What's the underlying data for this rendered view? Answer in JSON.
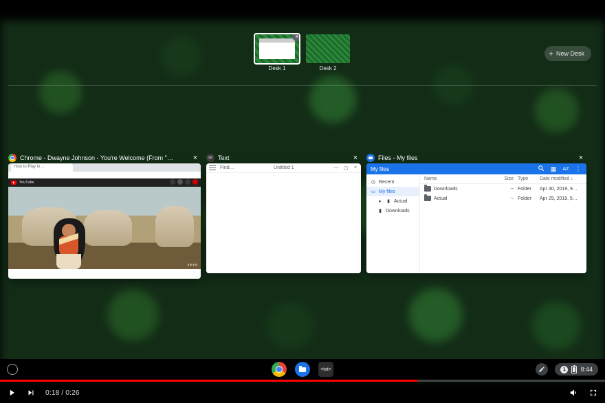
{
  "desks": {
    "items": [
      {
        "label": "Desk 1",
        "active": true
      },
      {
        "label": "Desk 2",
        "active": false
      }
    ],
    "new_desk_label": "New Desk"
  },
  "overview": {
    "windows": [
      {
        "id": "chrome",
        "title": "Chrome - Dwayne Johnson - You're Welcome (From \"…",
        "tab_label": "How to Play in…",
        "yt_brand": "YouTube",
        "video_watermark": "vevo"
      },
      {
        "id": "text",
        "title": "Text",
        "find_label": "Find…",
        "doc_title": "Untitled 1"
      },
      {
        "id": "files",
        "title": "Files - My files",
        "topbar_title": "My files",
        "sidebar": [
          {
            "label": "Recent",
            "icon": "clock",
            "selected": false,
            "sub": false
          },
          {
            "label": "My files",
            "icon": "monitor",
            "selected": true,
            "sub": false
          },
          {
            "label": "Actual",
            "icon": "folder",
            "selected": false,
            "sub": true
          },
          {
            "label": "Downloads",
            "icon": "folder",
            "selected": false,
            "sub": true
          }
        ],
        "columns": {
          "name": "Name",
          "size": "Size",
          "type": "Type",
          "date": "Date modified ↓"
        },
        "rows": [
          {
            "name": "Downloads",
            "size": "--",
            "type": "Folder",
            "date": "Apr 30, 2019, 9…"
          },
          {
            "name": "Actual",
            "size": "--",
            "type": "Folder",
            "date": "Apr 29, 2019, 5…"
          }
        ]
      }
    ]
  },
  "shelf": {
    "text_app_label": "<txt>",
    "notification_count": "1",
    "clock": "8:44"
  },
  "player": {
    "current": "0:18",
    "duration": "0:26",
    "time_display": "0:18 / 0:26",
    "played_pct": 69
  }
}
